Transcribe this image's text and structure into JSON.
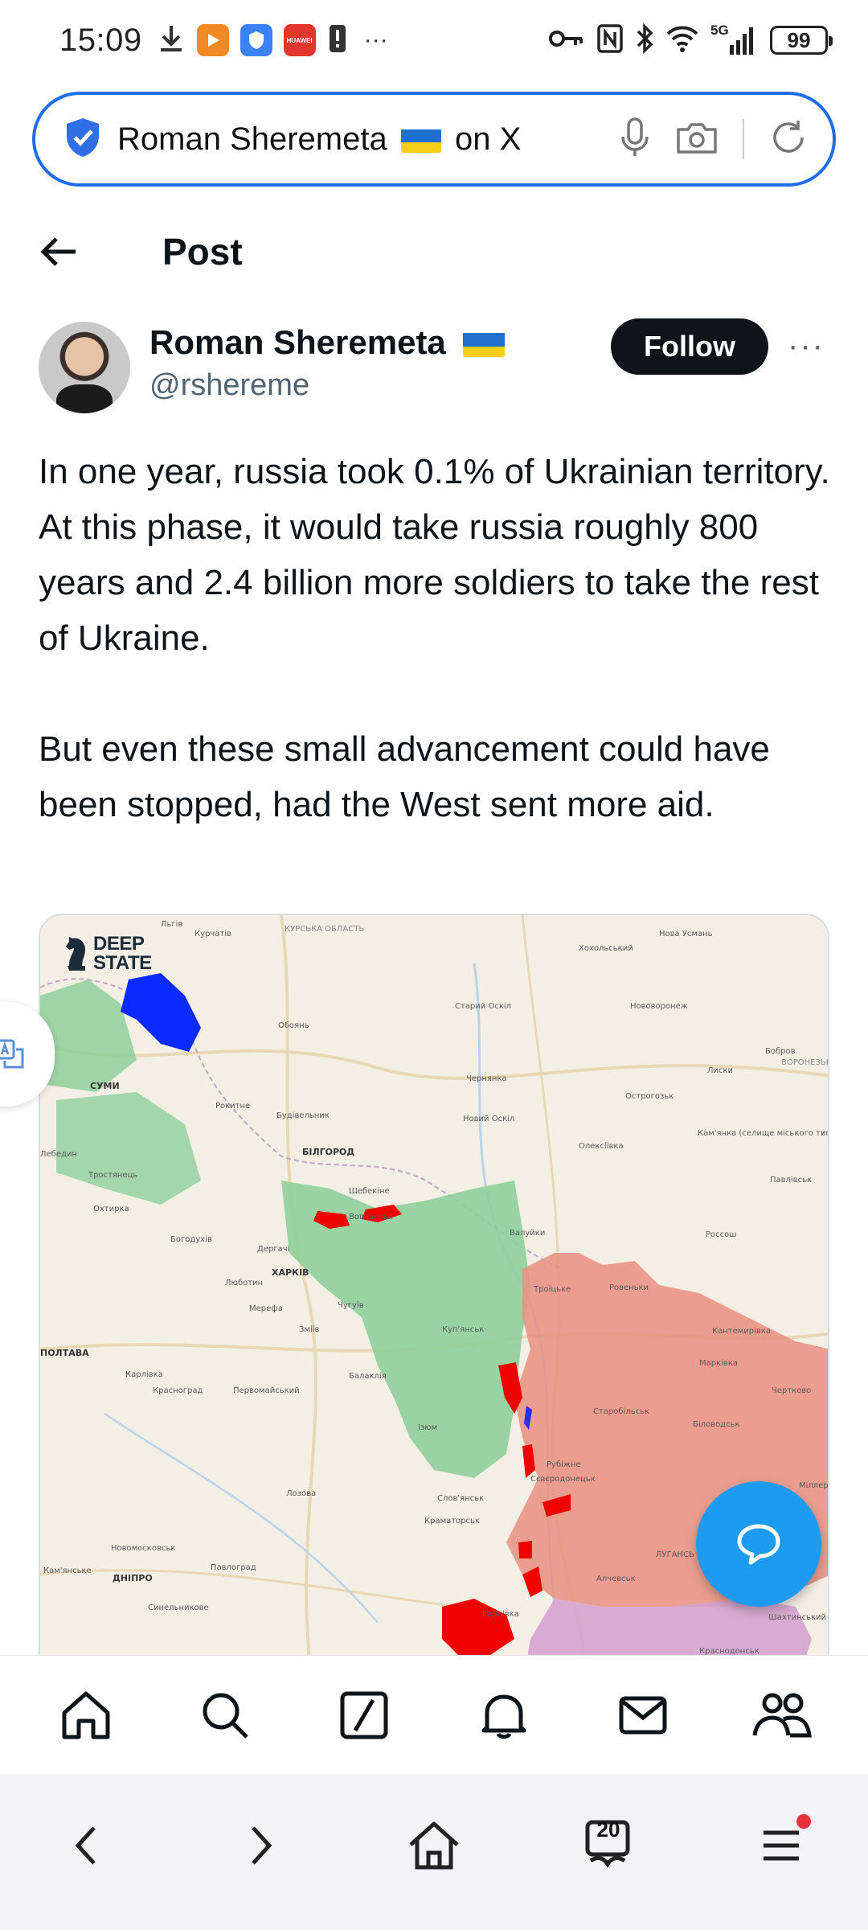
{
  "status_bar": {
    "time": "15:09",
    "overflow": "···",
    "battery": "99",
    "network": "5G",
    "icons": [
      "download-icon",
      "play-app-icon",
      "shield-app-icon",
      "huawei-app-icon",
      "alert-icon",
      "key-icon",
      "nfc-icon",
      "bluetooth-icon",
      "wifi-icon",
      "signal-icon",
      "battery-icon"
    ],
    "huawei_label": "HUAWEI"
  },
  "url_bar": {
    "title_prefix": "Roman Sheremeta",
    "title_suffix": "on X",
    "icons": [
      "verified-shield-icon",
      "microphone-icon",
      "camera-icon",
      "reload-icon"
    ]
  },
  "header": {
    "title": "Post"
  },
  "author": {
    "name": "Roman Sheremeta",
    "handle": "@rshereme",
    "follow_label": "Follow",
    "more_label": "···"
  },
  "post": {
    "paragraphs": [
      "In one year, russia took 0.1% of Ukrainian territory. At this phase, it would take russia roughly 800 years and 2.4 billion more soldiers to take the rest of Ukraine.",
      "But even these small advancement could have been stopped, had the West sent more aid."
    ]
  },
  "map": {
    "brand_line1": "DEEP",
    "brand_line2": "STATE",
    "labels": {
      "kursk_oblast": "КУРСЬКА ОБЛАСТЬ",
      "lviv": "Льгів",
      "kurchatov": "Курчатів",
      "khokholsky": "Хохольський",
      "nova_usman": "Нова Усмань",
      "staryi_oskil": "Старий Оскіл",
      "novovoronezh": "Нововоронеж",
      "oboyan": "Обоянь",
      "bobrov": "Бобров",
      "voronezh_oblast": "ВОРОНЕЗЬКА ОБЛАСТЬ",
      "sumy": "СУМИ",
      "chernianka": "Чернянка",
      "liski": "Лиски",
      "rokytne": "Рокитне",
      "ostrogozhsk": "Острогозьк",
      "kaminka": "Кам'янка (селище міського типу, Воронезька область)",
      "budy": "Будівельник",
      "novyi_oskil": "Новий Оскіл",
      "lebedyn": "Лебедин",
      "bilhorod": "БІЛГОРОД",
      "oleksiivka": "Олексіївка",
      "pavlivsk": "Павлівськ",
      "trostianets": "Тростянець",
      "shebekine": "Шебекіне",
      "okhtyrka": "Охтирка",
      "vovchansk": "Вовчанськ",
      "valuiky": "Валуйки",
      "rossosh": "Россош",
      "bohodukhiv": "Богодухів",
      "derhachi": "Дергачі",
      "kharkiv": "ХАРКІВ",
      "troitske": "Троїцьке",
      "rovenky": "Ровеньки",
      "liubotyn": "Люботин",
      "chuhuiv": "Чугуїв",
      "merefa": "Мерефа",
      "kupiansk": "Куп'янськ",
      "kantemyrivka": "Кантемирівка",
      "zmiiv": "Зміїв",
      "poltava": "ПОЛТАВА",
      "markivka": "Марківка",
      "karlivka": "Карлівка",
      "balakliia": "Балаклія",
      "krasnohrad": "Красноград",
      "pervomaiskyi": "Первомайський",
      "chertkovo": "Чертково",
      "starobilsk": "Старобільськ",
      "izium": "Ізюм",
      "bilovodsk": "Біловодськ",
      "rubizhne": "Рубіжне",
      "sievierodonetsk": "Сєвєродонецьк",
      "lozova": "Лозова",
      "sloviansk": "Слов'янськ",
      "kramatorsk": "Краматорськ",
      "millerovo": "Міллер",
      "novomoskovsk": "Новомосковськ",
      "luhansk": "ЛУГАНСЬ",
      "pavlohrad": "Павлоград",
      "alchevsk": "Алчевськ",
      "kamianske": "Кам'янське",
      "dnipro": "ДНІПРО",
      "synelnykove": "Синельникове",
      "horlivka": "Горлівка",
      "shakhtinskyi": "Шахтинський",
      "krasnyi": "Краснодонськ"
    }
  },
  "x_nav": {
    "icons": [
      "home-icon",
      "search-icon",
      "grok-icon",
      "notifications-icon",
      "messages-icon",
      "communities-icon"
    ]
  },
  "browser_bar": {
    "tabs_count": "20",
    "icons": [
      "back-icon",
      "forward-icon",
      "home-icon",
      "tabs-icon",
      "menu-icon"
    ]
  },
  "colors": {
    "accent_blue": "#1d6ee8",
    "x_blue": "#1d9bf0",
    "occupied_red": "#e98f80",
    "liberated_green": "#8fcf9b",
    "gray_zone": "#d6a3cf",
    "advance_red": "#f00000"
  }
}
